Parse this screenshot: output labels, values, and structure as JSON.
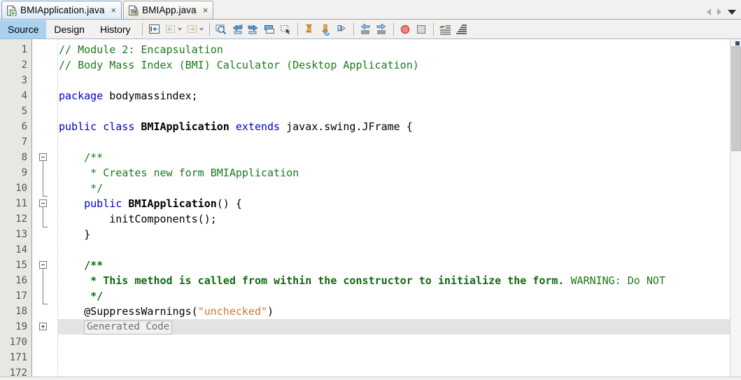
{
  "window": {
    "tabs": [
      {
        "label": "BMIApplication.java",
        "icon": "java-main-class-icon",
        "close": "×",
        "active": true
      },
      {
        "label": "BMIApp.java",
        "icon": "java-form-class-icon",
        "close": "×",
        "active": false
      }
    ],
    "nav": {
      "scroll_left": "scroll-tabs-left",
      "scroll_right": "scroll-tabs-right",
      "dropdown": "tab-list-dropdown"
    }
  },
  "toolbar": {
    "view_tabs": [
      {
        "label": "Source",
        "active": true
      },
      {
        "label": "Design",
        "active": false
      },
      {
        "label": "History",
        "active": false
      }
    ],
    "buttons": [
      {
        "name": "last-edit-position-icon"
      },
      {
        "name": "back-icon"
      },
      {
        "name": "forward-icon"
      },
      {
        "name": "find-selection-icon"
      },
      {
        "name": "find-previous-icon"
      },
      {
        "name": "find-next-icon"
      },
      {
        "name": "toggle-rectangular-selection-icon"
      },
      {
        "name": "select-in-projects-icon"
      },
      {
        "name": "previous-bookmark-icon"
      },
      {
        "name": "next-bookmark-icon"
      },
      {
        "name": "toggle-bookmark-icon"
      },
      {
        "name": "shift-line-left-icon"
      },
      {
        "name": "shift-line-right-icon"
      },
      {
        "name": "toggle-breakpoint-icon"
      },
      {
        "name": "stop-icon"
      },
      {
        "name": "comment-icon"
      },
      {
        "name": "uncomment-icon"
      }
    ]
  },
  "editor": {
    "line_numbers": [
      "1",
      "2",
      "3",
      "4",
      "5",
      "6",
      "7",
      "8",
      "9",
      "10",
      "11",
      "12",
      "13",
      "14",
      "15",
      "16",
      "17",
      "18",
      "19",
      "170",
      "171",
      "172"
    ],
    "fold_label": "Generated Code",
    "lines": [
      {
        "n": "1",
        "text": "// Module 2: Encapsulation"
      },
      {
        "n": "2",
        "text": "// Body Mass Index (BMI) Calculator (Desktop Application)"
      },
      {
        "n": "3",
        "text": ""
      },
      {
        "n": "4",
        "text": "package bodymassindex;"
      },
      {
        "n": "5",
        "text": ""
      },
      {
        "n": "6",
        "text": "public class BMIApplication extends javax.swing.JFrame {"
      },
      {
        "n": "7",
        "text": ""
      },
      {
        "n": "8",
        "text": "    /**"
      },
      {
        "n": "9",
        "text": "     * Creates new form BMIApplication"
      },
      {
        "n": "10",
        "text": "     */"
      },
      {
        "n": "11",
        "text": "    public BMIApplication() {"
      },
      {
        "n": "12",
        "text": "        initComponents();"
      },
      {
        "n": "13",
        "text": "    }"
      },
      {
        "n": "14",
        "text": ""
      },
      {
        "n": "15",
        "text": "    /**"
      },
      {
        "n": "16",
        "text": "     * This method is called from within the constructor to initialize the form. WARNING: Do NOT"
      },
      {
        "n": "17",
        "text": "     */"
      },
      {
        "n": "18",
        "text": "    @SuppressWarnings(\"unchecked\")"
      },
      {
        "n": "19",
        "text": "    Generated Code"
      },
      {
        "n": "170",
        "text": ""
      },
      {
        "n": "171",
        "text": ""
      },
      {
        "n": "172",
        "text": ""
      }
    ],
    "tokens": {
      "l1": "// Module 2: Encapsulation",
      "l2": "// Body Mass Index (BMI) Calculator (Desktop Application)",
      "l4_kw": "package",
      "l4_rest": " bodymassindex;",
      "l6_kw1": "public",
      "l6_kw2": "class",
      "l6_name": "BMIApplication",
      "l6_kw3": "extends",
      "l6_rest": "javax.swing.JFrame {",
      "l8": "/**",
      "l9": "* Creates new form BMIApplication",
      "l10": "*/",
      "l11_kw": "public",
      "l11_name": "BMIApplication",
      "l11_rest": "() {",
      "l12": "initComponents();",
      "l13": "}",
      "l15": "/**",
      "l16_bold": "* This method is called from within the constructor to initialize the form.",
      "l16_plain": " WARNING: Do NOT",
      "l17": "*/",
      "l18_anno": "@SuppressWarnings(",
      "l18_str": "\"unchecked\"",
      "l18_end": ")"
    }
  },
  "colors": {
    "keyword": "#0000cc",
    "comment": "#1a7a1a",
    "string": "#cc7832",
    "active_tab": "#a8d2f0",
    "gutter": "#e8e8e2",
    "highlight_row": "#e3e3e3"
  }
}
